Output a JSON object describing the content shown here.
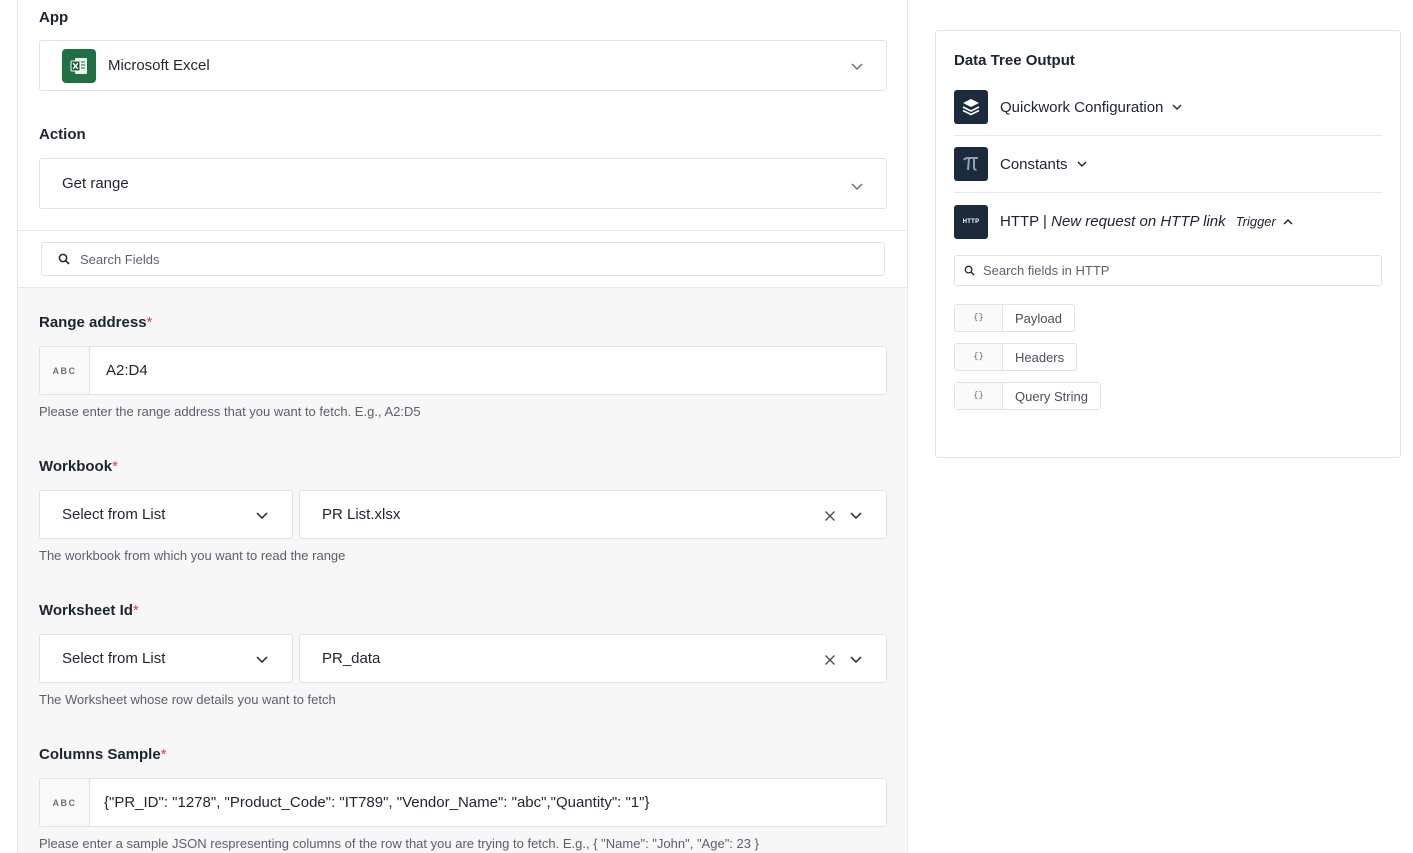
{
  "app_section": {
    "label": "App",
    "selected": "Microsoft Excel",
    "icon": "excel-icon"
  },
  "action_section": {
    "label": "Action",
    "selected": "Get range"
  },
  "search": {
    "placeholder": "Search Fields"
  },
  "fields": {
    "range_address": {
      "label": "Range address",
      "required_mark": "*",
      "type_badge": "ABC",
      "value": "A2:D4",
      "help": "Please enter the range address that you want to fetch. E.g., A2:D5"
    },
    "workbook": {
      "label": "Workbook",
      "required_mark": "*",
      "mode": "Select from List",
      "value": "PR List.xlsx",
      "help": "The workbook from which you want to read the range"
    },
    "worksheet_id": {
      "label": "Worksheet Id",
      "required_mark": "*",
      "mode": "Select from List",
      "value": "PR_data",
      "help": "The Worksheet whose row details you want to fetch"
    },
    "columns_sample": {
      "label": "Columns Sample",
      "required_mark": "*",
      "type_badge": "ABC",
      "value": "{\"PR_ID\": \"1278\", \"Product_Code\": \"IT789\", \"Vendor_Name\": \"abc\",\"Quantity\": \"1\"}",
      "help": "Please enter a sample JSON respresenting columns of the row that you are trying to fetch. E.g., { \"Name\": \"John\", \"Age\": 23 }"
    }
  },
  "data_tree": {
    "title": "Data Tree Output",
    "items": [
      {
        "label": "Quickwork Configuration",
        "icon": "layers-icon"
      },
      {
        "label": "Constants",
        "icon": "pi-icon"
      },
      {
        "label_prefix": "HTTP | ",
        "label_italic": "New request on HTTP link",
        "trigger": "Trigger",
        "icon": "http-icon",
        "icon_text": "HTTP"
      }
    ],
    "search_placeholder": "Search fields in HTTP",
    "chips": [
      {
        "brace": "{}",
        "label": "Payload"
      },
      {
        "brace": "{}",
        "label": "Headers"
      },
      {
        "brace": "{}",
        "label": "Query String"
      }
    ]
  }
}
